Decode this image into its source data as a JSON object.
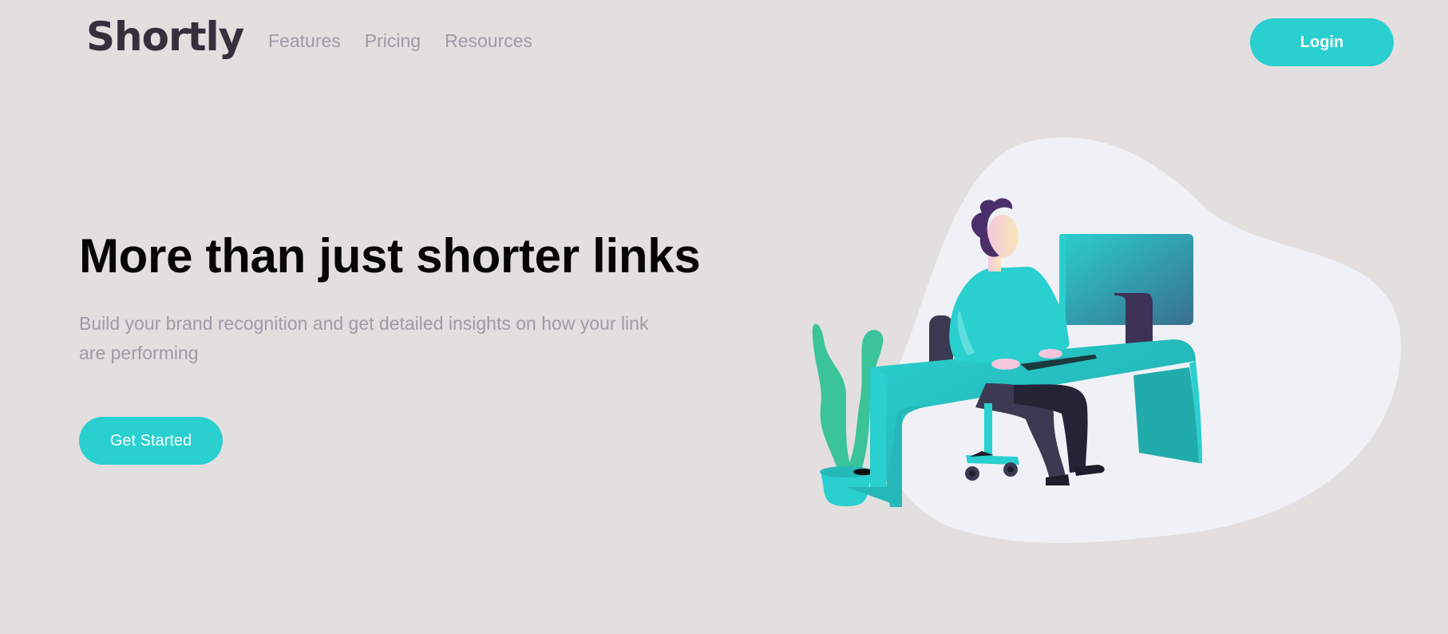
{
  "header": {
    "logo": "Shortly",
    "nav": [
      {
        "label": "Features"
      },
      {
        "label": "Pricing"
      },
      {
        "label": "Resources"
      }
    ],
    "login_label": "Login"
  },
  "hero": {
    "title": "More than just shorter links",
    "subtitle": "Build your brand recognition and get detailed insights on how your link are performing",
    "cta_label": "Get Started",
    "illustration": "person-working-at-desk"
  },
  "colors": {
    "background": "#e3dfdf",
    "accent": "#2acfcf",
    "dark": "#34313d",
    "muted": "#9e9aa7",
    "blob": "#f0f1f6",
    "plant": "#3bc39a",
    "hair": "#4b2f6b",
    "monitor": "#3a7c93"
  }
}
